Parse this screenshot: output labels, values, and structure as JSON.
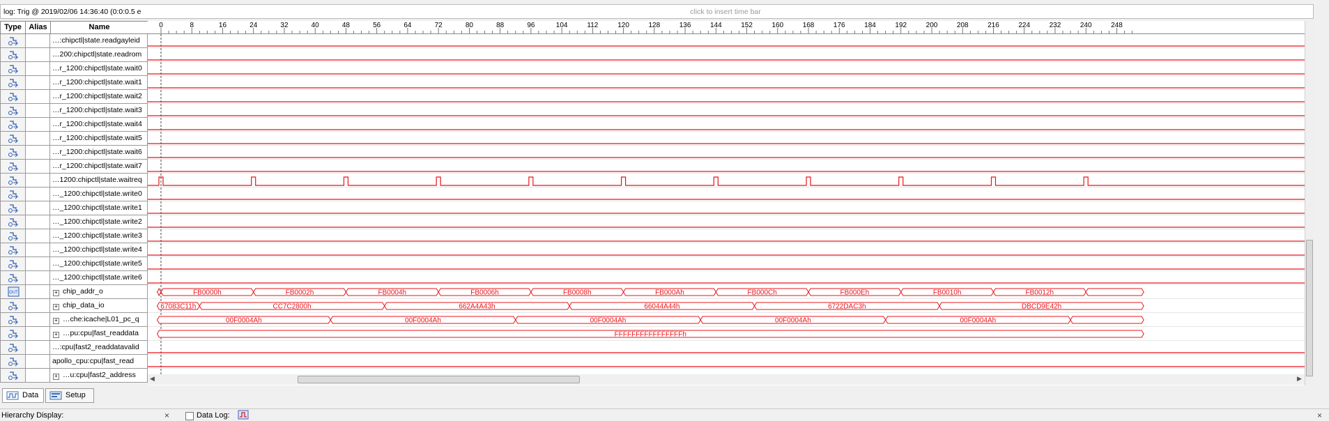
{
  "header": {
    "log_title": "log: Trig @ 2019/02/06 14:36:40 (0:0:0.5 e",
    "timebar_hint": "click to insert time bar"
  },
  "columns": {
    "type": "Type",
    "alias": "Alias",
    "name": "Name"
  },
  "time_ticks": [
    "0",
    "8",
    "16",
    "24",
    "32",
    "40",
    "48",
    "56",
    "64",
    "72",
    "80",
    "88",
    "96",
    "104",
    "112",
    "120",
    "128",
    "136",
    "144",
    "152",
    "160",
    "168",
    "176",
    "184",
    "192",
    "200",
    "208",
    "216",
    "224",
    "232",
    "240",
    "248"
  ],
  "signals": [
    {
      "name": "…:chipctl|state.readgayleid",
      "type": "input",
      "expandable": false,
      "wave": "low"
    },
    {
      "name": "…200:chipctl|state.readrom",
      "type": "input",
      "expandable": false,
      "wave": "low"
    },
    {
      "name": "…r_1200:chipctl|state.wait0",
      "type": "input",
      "expandable": false,
      "wave": "low"
    },
    {
      "name": "…r_1200:chipctl|state.wait1",
      "type": "input",
      "expandable": false,
      "wave": "low"
    },
    {
      "name": "…r_1200:chipctl|state.wait2",
      "type": "input",
      "expandable": false,
      "wave": "low"
    },
    {
      "name": "…r_1200:chipctl|state.wait3",
      "type": "input",
      "expandable": false,
      "wave": "low"
    },
    {
      "name": "…r_1200:chipctl|state.wait4",
      "type": "input",
      "expandable": false,
      "wave": "low"
    },
    {
      "name": "…r_1200:chipctl|state.wait5",
      "type": "input",
      "expandable": false,
      "wave": "low"
    },
    {
      "name": "…r_1200:chipctl|state.wait6",
      "type": "input",
      "expandable": false,
      "wave": "low"
    },
    {
      "name": "…r_1200:chipctl|state.wait7",
      "type": "input",
      "expandable": false,
      "wave": "low"
    },
    {
      "name": "…1200:chipctl|state.waitreq",
      "type": "input",
      "expandable": false,
      "wave": "pulse"
    },
    {
      "name": "…_1200:chipctl|state.write0",
      "type": "input",
      "expandable": false,
      "wave": "low"
    },
    {
      "name": "…_1200:chipctl|state.write1",
      "type": "input",
      "expandable": false,
      "wave": "low"
    },
    {
      "name": "…_1200:chipctl|state.write2",
      "type": "input",
      "expandable": false,
      "wave": "low"
    },
    {
      "name": "…_1200:chipctl|state.write3",
      "type": "input",
      "expandable": false,
      "wave": "low"
    },
    {
      "name": "…_1200:chipctl|state.write4",
      "type": "input",
      "expandable": false,
      "wave": "low"
    },
    {
      "name": "…_1200:chipctl|state.write5",
      "type": "input",
      "expandable": false,
      "wave": "low"
    },
    {
      "name": "…_1200:chipctl|state.write6",
      "type": "input",
      "expandable": false,
      "wave": "low"
    },
    {
      "name": "chip_addr_o",
      "type": "out",
      "expandable": true,
      "wave": "bus"
    },
    {
      "name": "chip_data_io",
      "type": "bidir",
      "expandable": true,
      "wave": "bus"
    },
    {
      "name": "…che:icache|L01_pc_q",
      "type": "bus",
      "expandable": true,
      "wave": "bus"
    },
    {
      "name": "…pu:cpu|fast_readdata",
      "type": "bus",
      "expandable": true,
      "wave": "bus"
    },
    {
      "name": "…:cpu|fast2_readdatavalid",
      "type": "input",
      "expandable": false,
      "wave": "low"
    },
    {
      "name": "apollo_cpu:cpu|fast_read",
      "type": "input",
      "expandable": false,
      "wave": "low"
    },
    {
      "name": "…u:cpu|fast2_address",
      "type": "bus",
      "expandable": true,
      "wave": "low"
    }
  ],
  "waitreq_pulses": [
    0,
    24,
    48,
    72,
    96,
    120,
    144,
    168,
    192,
    216,
    240
  ],
  "bus_segments": {
    "chip_addr_o": [
      {
        "from": -1,
        "to": 0,
        "label": ""
      },
      {
        "from": 0,
        "to": 24,
        "label": "FB0000h"
      },
      {
        "from": 24,
        "to": 48,
        "label": "FB0002h"
      },
      {
        "from": 48,
        "to": 72,
        "label": "FB0004h"
      },
      {
        "from": 72,
        "to": 96,
        "label": "FB0006h"
      },
      {
        "from": 96,
        "to": 120,
        "label": "FB0008h"
      },
      {
        "from": 120,
        "to": 144,
        "label": "FB000Ah"
      },
      {
        "from": 144,
        "to": 168,
        "label": "FB000Ch"
      },
      {
        "from": 168,
        "to": 192,
        "label": "FB000Eh"
      },
      {
        "from": 192,
        "to": 216,
        "label": "FB0010h"
      },
      {
        "from": 216,
        "to": 240,
        "label": "FB0012h"
      },
      {
        "from": 240,
        "to": 255,
        "label": ""
      }
    ],
    "chip_data_io": [
      {
        "from": -1,
        "to": 10,
        "label": "67083C11h"
      },
      {
        "from": 10,
        "to": 58,
        "label": "CC7C2800h"
      },
      {
        "from": 58,
        "to": 106,
        "label": "662A4A43h"
      },
      {
        "from": 106,
        "to": 154,
        "label": "66044A44h"
      },
      {
        "from": 154,
        "to": 202,
        "label": "6722DAC3h"
      },
      {
        "from": 202,
        "to": 255,
        "label": "DBCD9E42h"
      }
    ],
    "L01_pc_q": [
      {
        "from": -1,
        "to": 44,
        "label": "00F0004Ah"
      },
      {
        "from": 44,
        "to": 92,
        "label": "00F0004Ah"
      },
      {
        "from": 92,
        "to": 140,
        "label": "00F0004Ah"
      },
      {
        "from": 140,
        "to": 188,
        "label": "00F0004Ah"
      },
      {
        "from": 188,
        "to": 236,
        "label": "00F0004Ah"
      },
      {
        "from": 236,
        "to": 255,
        "label": ""
      }
    ],
    "fast_readdata": [
      {
        "from": -1,
        "to": 255,
        "label": "FFFFFFFFFFFFFFFFh"
      }
    ]
  },
  "tabs": [
    {
      "label": "Data",
      "icon": "data-tab-icon"
    },
    {
      "label": "Setup",
      "icon": "setup-tab-icon"
    }
  ],
  "bottom": {
    "hierarchy_label": "Hierarchy Display:",
    "datalog_label": "Data Log:",
    "close": "×"
  },
  "colors": {
    "wave": "#e8151b",
    "cursor": "#444444",
    "grid": "#d0d0d0"
  }
}
